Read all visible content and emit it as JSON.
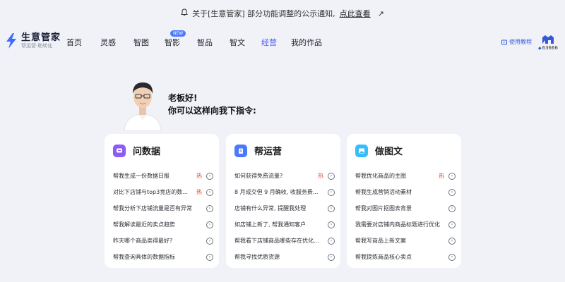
{
  "notice": {
    "prefix": "关于[生意管家] 部分功能调整的公示通知,",
    "link": "点此查看",
    "arrow": "↗"
  },
  "logo": {
    "title": "生意管家",
    "subtitle": "帮运营·助转化"
  },
  "menu": [
    {
      "label": "首页"
    },
    {
      "label": "灵感"
    },
    {
      "label": "智图"
    },
    {
      "label": "智影",
      "badge": "NEW"
    },
    {
      "label": "智品"
    },
    {
      "label": "智文"
    },
    {
      "label": "经营",
      "active": true
    },
    {
      "label": "我的作品"
    }
  ],
  "help": {
    "label": "使用教程"
  },
  "user": {
    "points": "63666"
  },
  "greeting": {
    "line1": "老板好!",
    "line2": "你可以这样向我下指令:"
  },
  "cards": [
    {
      "title": "问数据",
      "rows": [
        {
          "text": "帮我生成一份数据日报",
          "hot": "热"
        },
        {
          "text": "对比下店铺与top3竞店的数...",
          "hot": "热"
        },
        {
          "text": "帮我分析下店铺流量是否有异常"
        },
        {
          "text": "帮我解读最近的卖点趋势"
        },
        {
          "text": "昨天哪个商品卖得最好?"
        },
        {
          "text": "帮我查询具体的数据指标"
        }
      ]
    },
    {
      "title": "帮运营",
      "rows": [
        {
          "text": "如何获得免费流量?",
          "hot": "热"
        },
        {
          "text": "8 月成交但 9 月确收, 收服务费..."
        },
        {
          "text": "店铺有什么异常, 提醒我处理"
        },
        {
          "text": "如店铺上新了, 帮我通知客户"
        },
        {
          "text": "帮我看下店铺商品哪些存在优化..."
        },
        {
          "text": "帮我寻找优质货源"
        }
      ]
    },
    {
      "title": "做图文",
      "rows": [
        {
          "text": "帮我优化商品的主图",
          "hot": "热"
        },
        {
          "text": "帮我生成营销活动素材"
        },
        {
          "text": "帮我对图片抠图去背景"
        },
        {
          "text": "我需要对店铺内商品标题进行优化"
        },
        {
          "text": "帮我写商品上新文案"
        },
        {
          "text": "帮我提炼商品核心卖点"
        }
      ]
    }
  ],
  "colors": {
    "accent": "#4a5bf5",
    "hot": "#e0452b",
    "background": "#f1f2f8"
  }
}
